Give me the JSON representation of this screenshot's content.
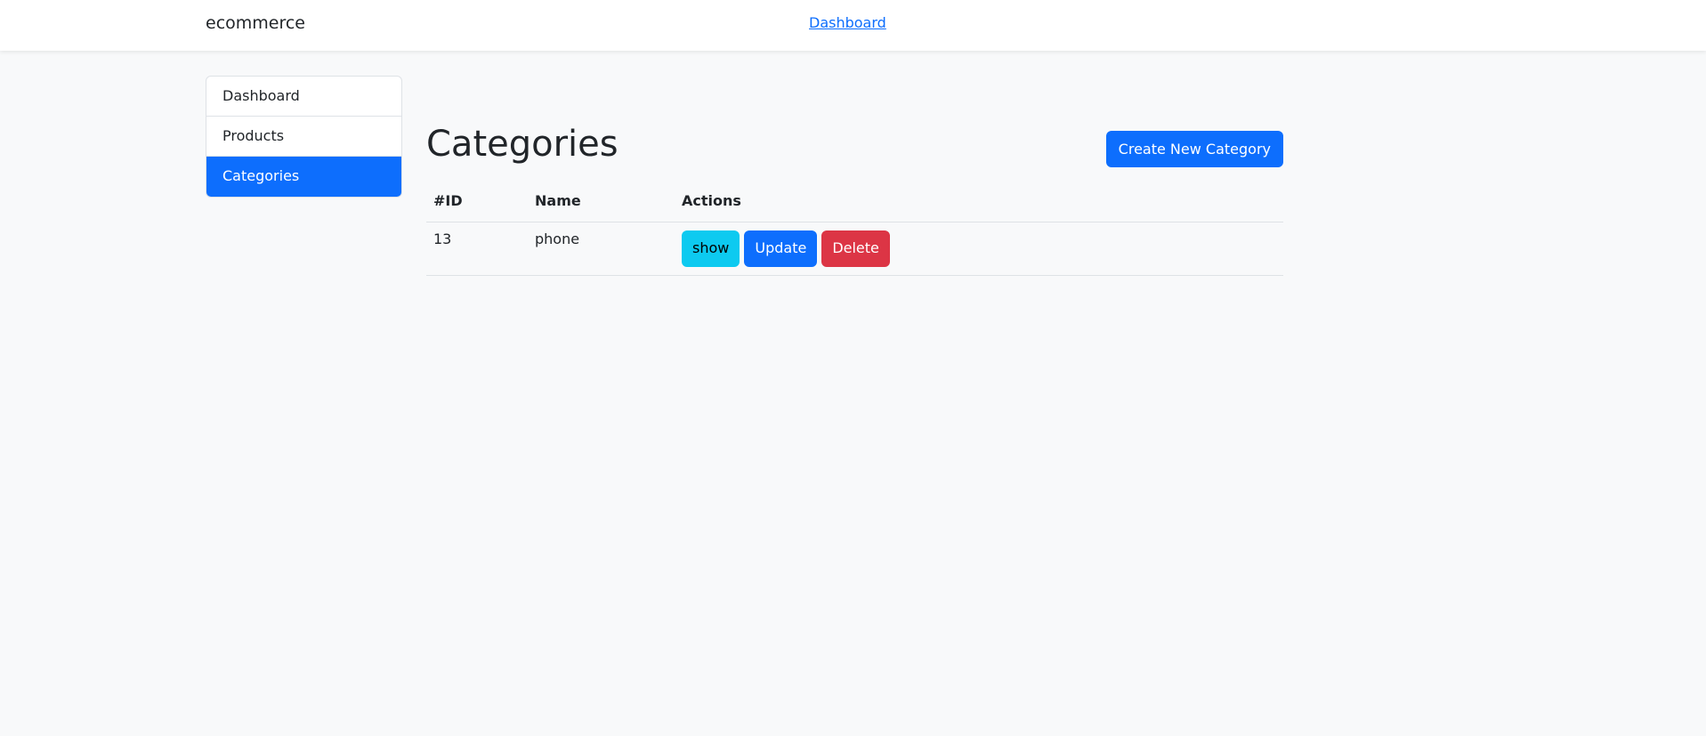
{
  "navbar": {
    "brand": "ecommerce",
    "link": "Dashboard"
  },
  "sidebar": {
    "items": [
      {
        "label": "Dashboard",
        "active": false
      },
      {
        "label": "Products",
        "active": false
      },
      {
        "label": "Categories",
        "active": true
      }
    ]
  },
  "main": {
    "title": "Categories",
    "create_button": "Create New Category",
    "table": {
      "headers": [
        "#ID",
        "Name",
        "Actions"
      ],
      "rows": [
        {
          "id": "13",
          "name": "phone",
          "actions": [
            "show",
            "Update",
            "Delete"
          ]
        }
      ]
    }
  },
  "colors": {
    "primary": "#0d6efd",
    "info": "#0dcaf0",
    "danger": "#dc3545",
    "page_background": "#f8f9fa"
  }
}
